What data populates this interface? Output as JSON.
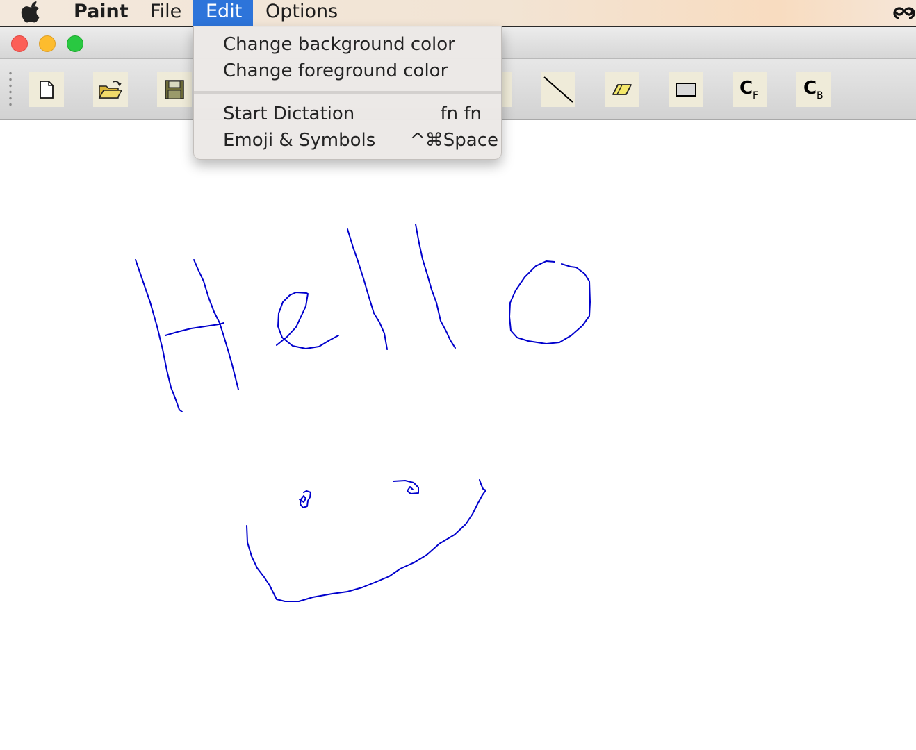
{
  "menubar": {
    "app_name": "Paint",
    "menus": [
      "File",
      "Edit",
      "Options"
    ],
    "active_menu": "Edit"
  },
  "edit_menu": {
    "items": [
      {
        "label": "Change background color",
        "shortcut": ""
      },
      {
        "label": "Change foreground color",
        "shortcut": ""
      },
      {
        "label": "Start Dictation",
        "shortcut": "fn fn"
      },
      {
        "label": "Emoji & Symbols",
        "shortcut": "^⌘Space"
      }
    ]
  },
  "toolbar": {
    "tools": [
      "new-file-icon",
      "open-folder-icon",
      "save-disk-icon",
      "line-tool-icon",
      "eraser-icon",
      "rectangle-tool-icon",
      "foreground-color-icon",
      "background-color-icon"
    ],
    "foreground_color_label": "C",
    "foreground_color_sub": "F",
    "background_color_label": "C",
    "background_color_sub": "B"
  },
  "colors": {
    "ink": "#0000cc",
    "menu_highlight": "#2d74da",
    "tool_button": "#efebd9"
  }
}
